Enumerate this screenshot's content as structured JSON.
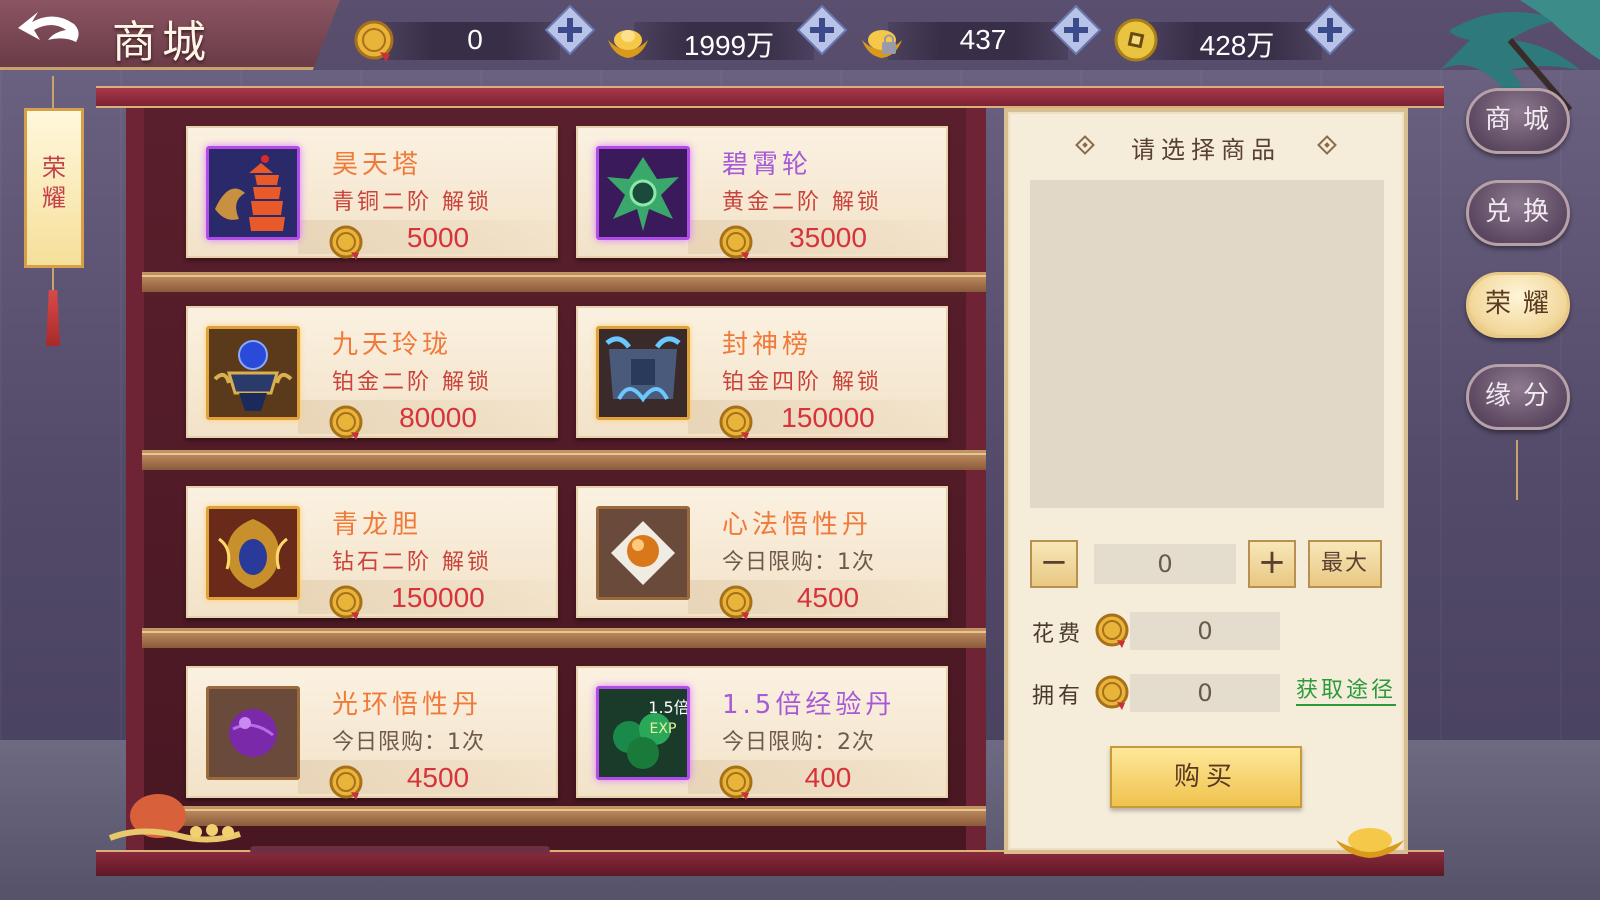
{
  "header": {
    "title": "商城",
    "currencies": [
      {
        "icon": "honor-coin-icon",
        "value": "0"
      },
      {
        "icon": "gold-ingot-icon",
        "value": "1999万"
      },
      {
        "icon": "bound-ingot-icon",
        "value": "437"
      },
      {
        "icon": "copper-coin-icon",
        "value": "428万"
      }
    ]
  },
  "left_banner": {
    "label": "荣\n耀"
  },
  "products": [
    {
      "name": "昊天塔",
      "condition": "青铜二阶 解锁",
      "price": "5000",
      "name_color": "orange",
      "icon": "pagoda-icon"
    },
    {
      "name": "碧霄轮",
      "condition": "黄金二阶 解锁",
      "price": "35000",
      "name_color": "purple",
      "icon": "wheel-icon"
    },
    {
      "name": "九天玲珑",
      "condition": "铂金二阶 解锁",
      "price": "80000",
      "name_color": "orange",
      "icon": "orb-artifact-icon"
    },
    {
      "name": "封神榜",
      "condition": "铂金四阶 解锁",
      "price": "150000",
      "name_color": "orange",
      "icon": "list-artifact-icon"
    },
    {
      "name": "青龙胆",
      "condition": "钻石二阶 解锁",
      "price": "150000",
      "name_color": "orange",
      "icon": "dragon-gall-icon"
    },
    {
      "name": "心法悟性丹",
      "condition": "今日限购：1次",
      "price": "4500",
      "name_color": "orange",
      "icon": "pill-orange-icon"
    },
    {
      "name": "光环悟性丹",
      "condition": "今日限购：1次",
      "price": "4500",
      "name_color": "orange",
      "icon": "pill-purple-icon"
    },
    {
      "name": "1.5倍经验丹",
      "condition": "今日限购：2次",
      "price": "400",
      "name_color": "purple",
      "icon": "exp-pill-icon",
      "badge_top": "1.5倍",
      "badge_bottom": "EXP"
    }
  ],
  "detail": {
    "title": "请选择商品",
    "quantity": "0",
    "max_label": "最大",
    "cost_label": "花费",
    "cost_value": "0",
    "own_label": "拥有",
    "own_value": "0",
    "get_link": "获取途径",
    "buy_label": "购买"
  },
  "side_tabs": [
    {
      "label": "商城",
      "active": false
    },
    {
      "label": "兑换",
      "active": false
    },
    {
      "label": "荣耀",
      "active": true
    },
    {
      "label": "缘分",
      "active": false
    }
  ],
  "colors": {
    "accent_red": "#d6333a",
    "name_orange": "#f07a3a",
    "name_purple": "#a65ad8",
    "link_green": "#2b9a3c"
  }
}
